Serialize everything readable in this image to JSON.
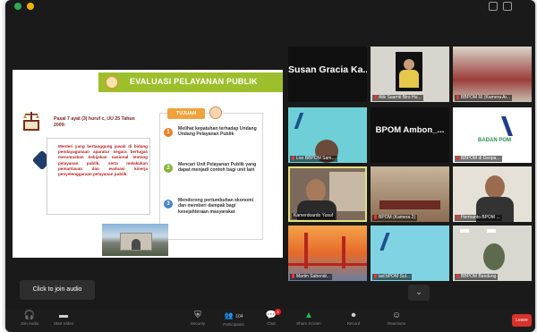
{
  "shared_slide": {
    "title": "EVALUASI PELAYANAN PUBLIK",
    "pasal_heading": "Pasal 7 ayat (3) huruf c, UU 25 Tahun 2009:",
    "pasal_text": "Menteri yang bertanggung jawab di bidang pendayagunaan aparatur negara bertugas merumuskan kebijakan nasional tentang pelayanan publik, serta melakukan pemantauan dan evaluasi kinerja penyelenggaraan pelayanan publik.",
    "tujuan_label": "TUJUAN",
    "tujuan_items": [
      {
        "num": "1",
        "text": "Melihat kepatuhan terhadap Undang Undang Pelayanan Publik",
        "color": "#e8832b"
      },
      {
        "num": "2",
        "text": "Mencari Unit Pelayanan Publik yang dapat menjadi contoh bagi unit lain",
        "color": "#8bb33a"
      },
      {
        "num": "3",
        "text": "Mendorong pertumbuhan ekonomi dan memberi dampak bagi kesejahteraan masyarakat",
        "color": "#4a86c5"
      }
    ]
  },
  "gallery": {
    "tiles": [
      {
        "id": "t1",
        "name": "",
        "big": "Susan Gracia Ka..."
      },
      {
        "id": "t2",
        "name": "Alik Suarnti Biro Hu..."
      },
      {
        "id": "t3",
        "name": "BBPOM RI (Kamera Ar..."
      },
      {
        "id": "t4",
        "name": "Loo BBPOM Sam..."
      },
      {
        "id": "t5",
        "name": "",
        "big": "BPOM Ambon_..."
      },
      {
        "id": "t6",
        "name": "BBPOM di Denpa..."
      },
      {
        "id": "t7",
        "name": "Kamerdoardo Yusuf"
      },
      {
        "id": "t8",
        "name": "BPOM (Kamera 2)"
      },
      {
        "id": "t9",
        "name": "Hermanto BPOM ..."
      },
      {
        "id": "t10",
        "name": "Martin Sahendr..."
      },
      {
        "id": "t11",
        "name": "iad bPOM Sul..."
      },
      {
        "id": "t12",
        "name": "BBPOM Bandung"
      }
    ]
  },
  "join_audio_label": "Click to join audio",
  "toolbar": {
    "audio": "Join Audio",
    "video": "Start Video",
    "security": "Security",
    "participants": "Participants",
    "participants_count": "104",
    "chat": "Chat",
    "chat_badge": "1",
    "share": "Share Screen",
    "record": "Record",
    "reactions": "Reactions",
    "leave": "Leave"
  },
  "colors": {
    "slide_header": "#9cbf2b",
    "active_speaker_border": "#e5e07a",
    "leave": "#d9312b"
  }
}
